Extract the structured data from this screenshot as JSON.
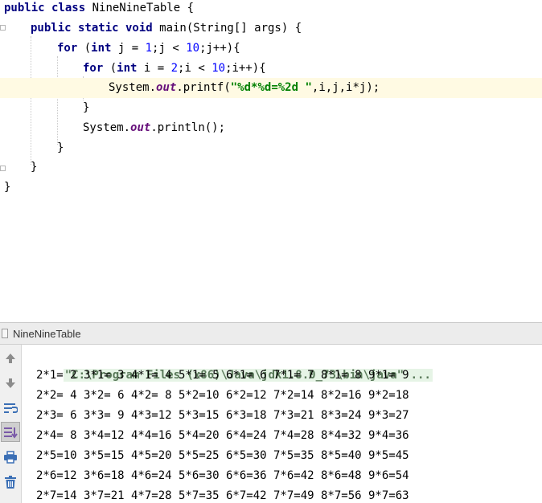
{
  "editor": {
    "lines": [
      {
        "tokens": [
          {
            "t": "kw",
            "v": "public class"
          },
          {
            "t": "txt",
            "v": " NineNineTable {"
          }
        ]
      },
      {
        "tokens": [
          {
            "t": "kw",
            "v": "public static void"
          },
          {
            "t": "txt",
            "v": " main(String[] args) {"
          }
        ]
      },
      {
        "tokens": [
          {
            "t": "kw",
            "v": "for"
          },
          {
            "t": "txt",
            "v": " ("
          },
          {
            "t": "kw",
            "v": "int"
          },
          {
            "t": "txt",
            "v": " j = "
          },
          {
            "t": "num",
            "v": "1"
          },
          {
            "t": "txt",
            "v": ";j < "
          },
          {
            "t": "num",
            "v": "10"
          },
          {
            "t": "txt",
            "v": ";j++){"
          }
        ]
      },
      {
        "tokens": [
          {
            "t": "kw",
            "v": "for"
          },
          {
            "t": "txt",
            "v": " ("
          },
          {
            "t": "kw",
            "v": "int"
          },
          {
            "t": "txt",
            "v": " i = "
          },
          {
            "t": "num",
            "v": "2"
          },
          {
            "t": "txt",
            "v": ";i < "
          },
          {
            "t": "num",
            "v": "10"
          },
          {
            "t": "txt",
            "v": ";i++){"
          }
        ]
      },
      {
        "tokens": [
          {
            "t": "txt",
            "v": "System."
          },
          {
            "t": "fld",
            "v": "out"
          },
          {
            "t": "txt",
            "v": ".printf("
          },
          {
            "t": "str",
            "v": "\"%d*%d=%2d \""
          },
          {
            "t": "txt",
            "v": ",i,j,i*j);"
          }
        ]
      },
      {
        "tokens": [
          {
            "t": "txt",
            "v": "}"
          }
        ]
      },
      {
        "tokens": [
          {
            "t": "txt",
            "v": "System."
          },
          {
            "t": "fld",
            "v": "out"
          },
          {
            "t": "txt",
            "v": ".println();"
          }
        ]
      },
      {
        "tokens": [
          {
            "t": "txt",
            "v": "}"
          }
        ]
      },
      {
        "tokens": [
          {
            "t": "txt",
            "v": "}"
          }
        ]
      },
      {
        "tokens": [
          {
            "t": "txt",
            "v": "}"
          }
        ]
      }
    ]
  },
  "run_panel": {
    "tab_label": "NineNineTable",
    "command": "\"C:\\Program Files (x86)\\Java\\jdk1.8.0_73\\bin\\java\" ...",
    "output_lines": [
      "2*1= 2 3*1= 3 4*1= 4 5*1= 5 6*1= 6 7*1= 7 8*1= 8 9*1= 9",
      "2*2= 4 3*2= 6 4*2= 8 5*2=10 6*2=12 7*2=14 8*2=16 9*2=18",
      "2*3= 6 3*3= 9 4*3=12 5*3=15 6*3=18 7*3=21 8*3=24 9*3=27",
      "2*4= 8 3*4=12 4*4=16 5*4=20 6*4=24 7*4=28 8*4=32 9*4=36",
      "2*5=10 3*5=15 4*5=20 5*5=25 6*5=30 7*5=35 8*5=40 9*5=45",
      "2*6=12 3*6=18 4*6=24 5*6=30 6*6=36 7*6=42 8*6=48 9*6=54",
      "2*7=14 3*7=21 4*7=28 5*7=35 6*7=42 7*7=49 8*7=56 9*7=63"
    ],
    "toolbar_icons": [
      "arrow-up-icon",
      "arrow-down-icon",
      "soft-wrap-icon",
      "scroll-to-end-icon",
      "print-icon",
      "trash-icon"
    ]
  },
  "colors": {
    "keyword": "#000080",
    "number": "#0000ff",
    "string": "#008000",
    "static_field": "#660e7a",
    "current_line": "#fffae3"
  }
}
